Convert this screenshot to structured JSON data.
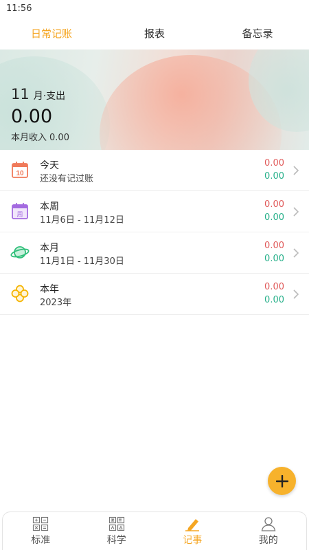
{
  "status_bar": {
    "time": "11:56"
  },
  "top_tabs": [
    {
      "label": "日常记账",
      "active": true
    },
    {
      "label": "报表",
      "active": false
    },
    {
      "label": "备忘录",
      "active": false
    }
  ],
  "banner": {
    "month": "11",
    "month_suffix": "月·支出",
    "amount": "0.00",
    "income_label": "本月收入",
    "income_value": "0.00"
  },
  "summary": [
    {
      "title": "今天",
      "subtitle": "还没有记过账",
      "expense": "0.00",
      "income": "0.00",
      "icon": "calendar-10-icon"
    },
    {
      "title": "本周",
      "subtitle": "11月6日 - 11月12日",
      "expense": "0.00",
      "income": "0.00",
      "icon": "calendar-week-icon"
    },
    {
      "title": "本月",
      "subtitle": "11月1日 - 11月30日",
      "expense": "0.00",
      "income": "0.00",
      "icon": "planet-icon"
    },
    {
      "title": "本年",
      "subtitle": "2023年",
      "expense": "0.00",
      "income": "0.00",
      "icon": "clover-icon"
    }
  ],
  "calendar_icon_day": "10",
  "calendar_week_glyph": "周",
  "bottom_nav": [
    {
      "label": "标准",
      "icon": "calculator-standard-icon",
      "active": false
    },
    {
      "label": "科学",
      "icon": "calculator-scientific-icon",
      "active": false
    },
    {
      "label": "记事",
      "icon": "pencil-icon",
      "active": true
    },
    {
      "label": "我的",
      "icon": "user-icon",
      "active": false
    }
  ],
  "colors": {
    "accent": "#f5a623",
    "expense": "#e05a5a",
    "income": "#27b08a",
    "fab": "#f7b22c"
  }
}
